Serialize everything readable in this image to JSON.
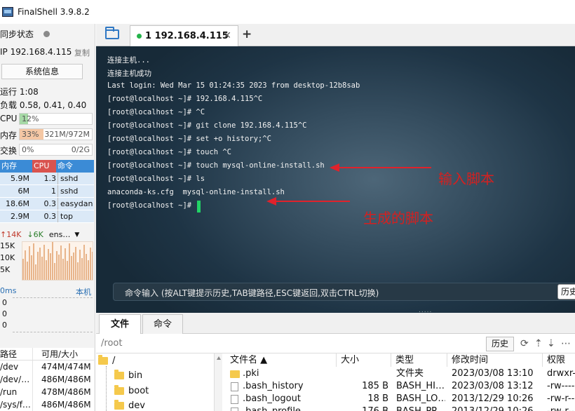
{
  "window": {
    "title": "FinalShell 3.9.8.2"
  },
  "sidebar": {
    "sync_label": "同步状态",
    "ip_label": "IP  192.168.4.115",
    "copy_label": "复制",
    "sysinfo_button": "系统信息",
    "uptime": "运行 1:08",
    "load": "负载 0.58, 0.41, 0.40",
    "cpu": {
      "label": "CPU",
      "text": "12%",
      "fraction": 0.12,
      "color": "#a6d9a6"
    },
    "mem": {
      "label": "内存",
      "text": "33%",
      "detail": "321M/972M",
      "fraction": 0.33,
      "color": "#f4c7a4"
    },
    "swap": {
      "label": "交换",
      "text": "0%",
      "detail": "0/2G",
      "fraction": 0.0,
      "color": "#d0d0d0"
    },
    "process_header": {
      "mem": "内存",
      "cpu": "CPU",
      "cmd": "命令"
    },
    "processes": [
      {
        "mem": "5.9M",
        "cpu": "1.3",
        "cmd": "sshd"
      },
      {
        "mem": "6M",
        "cpu": "1",
        "cmd": "sshd"
      },
      {
        "mem": "18.6M",
        "cpu": "0.3",
        "cmd": "easydan"
      },
      {
        "mem": "2.9M",
        "cpu": "0.3",
        "cmd": "top"
      }
    ],
    "net": {
      "up": "↑14K",
      "down": "↓6K",
      "iface": "ens…",
      "y_labels": [
        "15K",
        "10K",
        "5K"
      ]
    },
    "latency": {
      "label": "0ms",
      "host": "本机",
      "y_labels": [
        "0",
        "0",
        "0"
      ]
    },
    "disk_header": {
      "path": "路径",
      "size": "可用/大小"
    },
    "disks": [
      {
        "path": "/dev",
        "size": "474M/474M"
      },
      {
        "path": "/dev/…",
        "size": "486M/486M"
      },
      {
        "path": "/run",
        "size": "478M/486M"
      },
      {
        "path": "/sys/f…",
        "size": "486M/486M"
      }
    ]
  },
  "tabs": {
    "session_label": "1 192.168.4.115",
    "close": "✕",
    "add": "+"
  },
  "terminal": {
    "lines": [
      "连接主机...",
      "连接主机成功",
      "Last login: Wed Mar 15 01:24:35 2023 from desktop-12b8sab",
      "[root@localhost ~]# 192.168.4.115^C",
      "[root@localhost ~]# ^C",
      "[root@localhost ~]# git clone 192.168.4.115^C",
      "[root@localhost ~]# set +o history;^C",
      "[root@localhost ~]# touch ^C",
      "[root@localhost ~]# touch mysql-online-install.sh",
      "[root@localhost ~]# ls",
      "anaconda-ks.cfg  mysql-online-install.sh",
      "[root@localhost ~]# "
    ],
    "annotation_input": "输入脚本",
    "annotation_generated": "生成的脚本",
    "accent_color": "#e0222b",
    "cmd_input_hint": "命令输入 (按ALT键提示历史,TAB键路径,ESC键返回,双击CTRL切换)",
    "history_btn": "历史",
    "grip": "....."
  },
  "bottom": {
    "tabs": [
      "文件",
      "命令"
    ],
    "path": "/root",
    "history_btn": "历史",
    "tree": [
      "/",
      "bin",
      "boot",
      "dev"
    ],
    "columns": [
      "文件名 ▲",
      "大小",
      "类型",
      "修改时间",
      "权限"
    ],
    "files": [
      {
        "name": ".pki",
        "size": "",
        "type": "文件夹",
        "mtime": "2023/03/08 13:10",
        "perm": "drwxr-",
        "is_folder": true
      },
      {
        "name": ".bash_history",
        "size": "185 B",
        "type": "BASH_HI…",
        "mtime": "2023/03/08 13:12",
        "perm": "-rw----",
        "is_folder": false
      },
      {
        "name": ".bash_logout",
        "size": "18 B",
        "type": "BASH_LO…",
        "mtime": "2013/12/29 10:26",
        "perm": "-rw-r--",
        "is_folder": false
      },
      {
        "name": ".bash_profile",
        "size": "176 B",
        "type": "BASH_PR…",
        "mtime": "2013/12/29 10:26",
        "perm": "-rw-r--",
        "is_folder": false
      }
    ]
  }
}
